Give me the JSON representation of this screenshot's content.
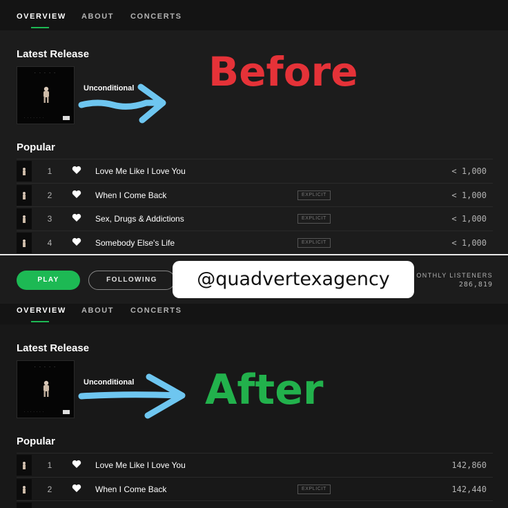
{
  "tabs": [
    "OVERVIEW",
    "ABOUT",
    "CONCERTS"
  ],
  "annotations": {
    "before": "Before",
    "after": "After",
    "watermark": "@quadvertexagency"
  },
  "colors": {
    "accent": "#1db954",
    "before_text": "#e53238",
    "after_text": "#22b14c",
    "arrow": "#6ec6f0"
  },
  "before": {
    "latest_release_title": "Latest Release",
    "release_name": "Unconditional",
    "popular_title": "Popular",
    "tracks": [
      {
        "num": "1",
        "name": "Love Me Like I Love You",
        "explicit": "",
        "plays": "< 1,000"
      },
      {
        "num": "2",
        "name": "When I Come Back",
        "explicit": "EXPLICIT",
        "plays": "< 1,000"
      },
      {
        "num": "3",
        "name": "Sex, Drugs & Addictions",
        "explicit": "EXPLICIT",
        "plays": "< 1,000"
      },
      {
        "num": "4",
        "name": "Somebody Else's Life",
        "explicit": "EXPLICIT",
        "plays": "< 1,000"
      }
    ]
  },
  "controls": {
    "play": "PLAY",
    "follow": "FOLLOWING",
    "listeners_label": "ONTHLY LISTENERS",
    "listeners_value": "286,819"
  },
  "after": {
    "latest_release_title": "Latest Release",
    "release_name": "Unconditional",
    "popular_title": "Popular",
    "tracks": [
      {
        "num": "1",
        "name": "Love Me Like I Love You",
        "explicit": "",
        "plays": "142,860"
      },
      {
        "num": "2",
        "name": "When I Come Back",
        "explicit": "EXPLICIT",
        "plays": "142,440"
      }
    ]
  }
}
